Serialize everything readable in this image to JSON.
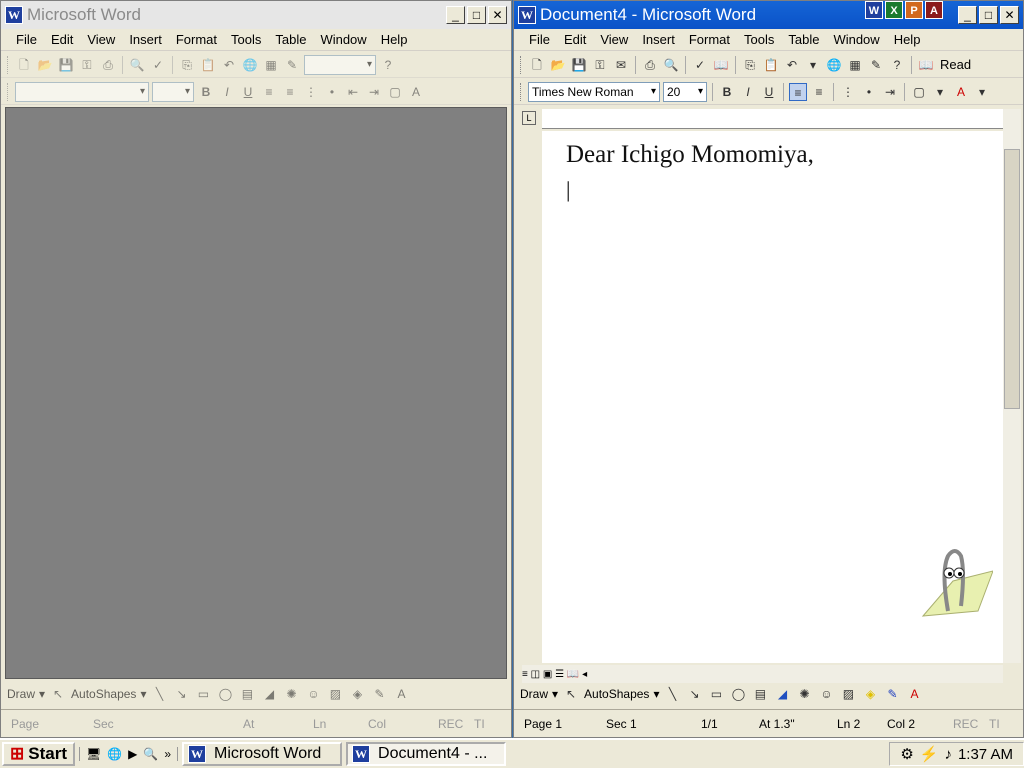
{
  "left_window": {
    "title": "Microsoft Word",
    "menu": [
      "File",
      "Edit",
      "View",
      "Insert",
      "Format",
      "Tools",
      "Table",
      "Window",
      "Help"
    ],
    "status": [
      "Page",
      "Sec",
      "At",
      "Ln",
      "Col",
      "REC",
      "TI"
    ],
    "draw_label": "Draw",
    "autoshapes_label": "AutoShapes"
  },
  "right_window": {
    "title": "Document4 - Microsoft Word",
    "menu": [
      "File",
      "Edit",
      "View",
      "Insert",
      "Format",
      "Tools",
      "Table",
      "Window",
      "Help"
    ],
    "read_label": "Read",
    "font_name": "Times New Roman",
    "font_size": "20",
    "doc_line1": "Dear Ichigo Momomiya,",
    "status": {
      "page": "Page 1",
      "sec": "Sec 1",
      "pages": "1/1",
      "at": "At 1.3\"",
      "ln": "Ln 2",
      "col": "Col 2",
      "rec": "REC",
      "tr": "TI"
    },
    "draw_label": "Draw",
    "autoshapes_label": "AutoShapes"
  },
  "taskbar": {
    "start_label": "Start",
    "task1": "Microsoft Word",
    "task2": "Document4 - ...",
    "clock": "1:37 AM"
  }
}
